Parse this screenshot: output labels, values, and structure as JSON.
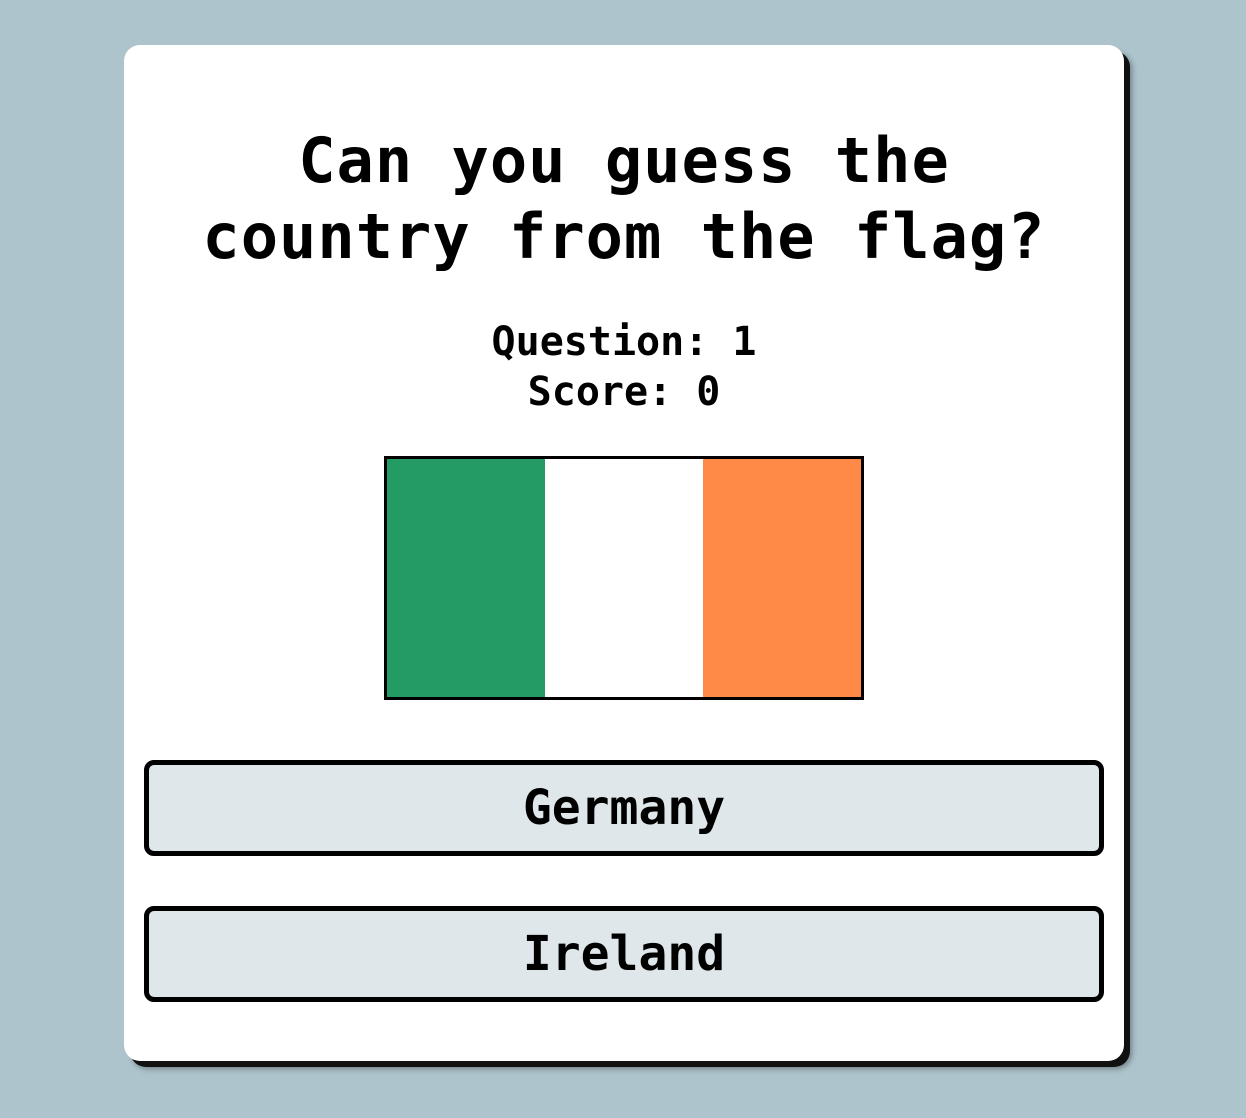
{
  "quiz": {
    "title_line1": "Can you guess the",
    "title_line2": "country from the flag?",
    "question_label": "Question: 1",
    "score_label": "Score: 0"
  },
  "flag": {
    "stripes": [
      "#249a64",
      "#ffffff",
      "#ff8a47"
    ]
  },
  "answers": [
    {
      "label": "Germany"
    },
    {
      "label": "Ireland"
    }
  ],
  "colors": {
    "background": "#adc4cc",
    "button_fill": "#dfe7ea"
  }
}
